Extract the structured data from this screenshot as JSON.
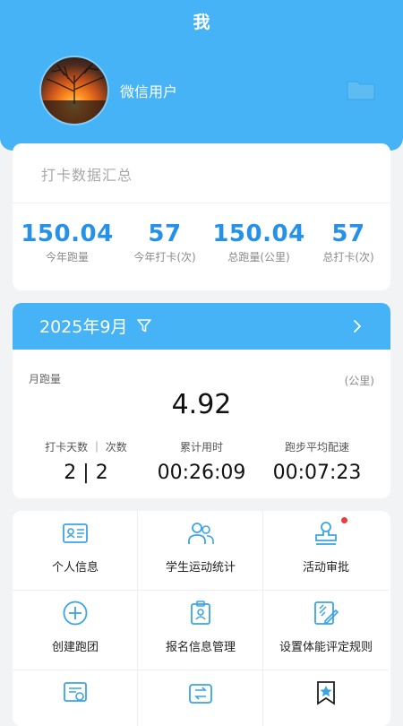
{
  "header": {
    "title": "我",
    "username": "微信用户",
    "avatar_icon": "sunset-avatar-image",
    "corner_icon": "folder-icon"
  },
  "summary": {
    "title": "打卡数据汇总",
    "stats": [
      {
        "value": "150.04",
        "label": "今年跑量"
      },
      {
        "value": "57",
        "label": "今年打卡(次)"
      },
      {
        "value": "150.04",
        "label": "总跑量(公里)"
      },
      {
        "value": "57",
        "label": "总打卡(次)"
      }
    ]
  },
  "month": {
    "title": "2025年9月",
    "filter_icon": "filter-icon",
    "next_icon": "chevron-right-icon",
    "distance_label": "月跑量",
    "unit": "(公里)",
    "distance_value": "4.92",
    "stats": [
      {
        "label": "打卡天数 ｜ 次数",
        "value": "2 | 2"
      },
      {
        "label": "累计用时",
        "value": "00:26:09"
      },
      {
        "label": "跑步平均配速",
        "value": "00:07:23"
      }
    ]
  },
  "menu": {
    "items": [
      {
        "label": "个人信息",
        "icon": "id-card-icon"
      },
      {
        "label": "学生运动统计",
        "icon": "users-icon"
      },
      {
        "label": "活动审批",
        "icon": "stamp-icon",
        "badge": true
      },
      {
        "label": "创建跑团",
        "icon": "plus-circle-icon"
      },
      {
        "label": "报名信息管理",
        "icon": "badge-icon"
      },
      {
        "label": "设置体能评定规则",
        "icon": "edit-rules-icon"
      },
      {
        "label": "",
        "icon": "certificate-icon"
      },
      {
        "label": "",
        "icon": "wallet-transfer-icon"
      },
      {
        "label": "",
        "icon": "star-bookmark-icon"
      }
    ]
  },
  "colors": {
    "accent": "#45b3f5",
    "number_blue": "#2592e8",
    "background": "#f2f3f5",
    "badge_red": "#ee3b3b"
  }
}
